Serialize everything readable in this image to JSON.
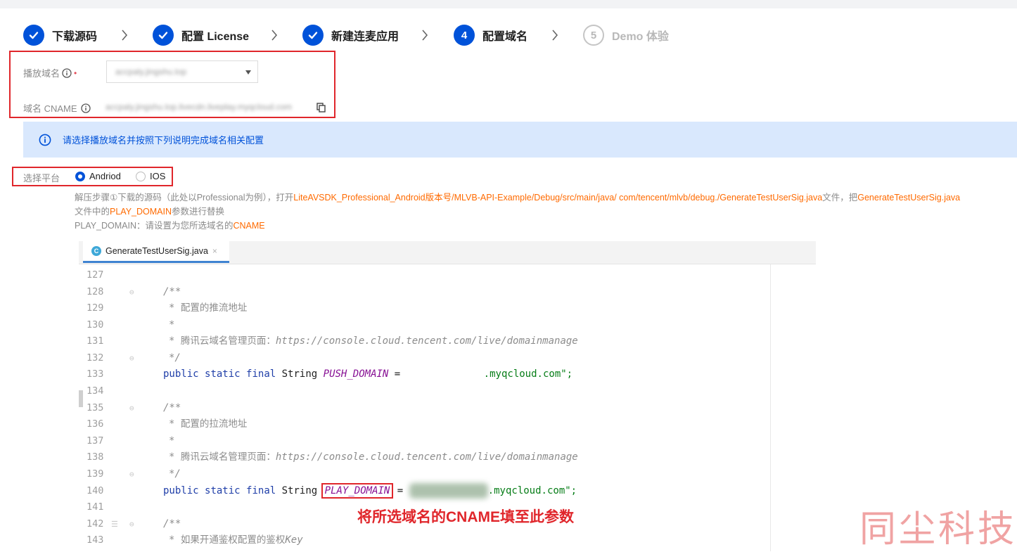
{
  "steps": [
    {
      "label": "下载源码",
      "state": "done",
      "icon": "check-icon"
    },
    {
      "label": "配置 License",
      "state": "done",
      "icon": "check-icon"
    },
    {
      "label": "新建连麦应用",
      "state": "done",
      "icon": "check-icon"
    },
    {
      "label": "配置域名",
      "state": "active",
      "number": "4"
    },
    {
      "label": "Demo 体验",
      "state": "todo",
      "number": "5"
    }
  ],
  "form": {
    "play_domain_label": "播放域名",
    "required_mark": "•",
    "play_domain_value": "accpaly.jingshu.top",
    "cname_label": "域名 CNAME",
    "cname_value": "accpaly.jingshu.top.livecdn.liveplay.myqcloud.com"
  },
  "banner": {
    "text": "请选择播放域名并按照下列说明完成域名相关配置"
  },
  "platform": {
    "label": "选择平台",
    "options": [
      {
        "label": "Andriod",
        "selected": true
      },
      {
        "label": "IOS",
        "selected": false
      }
    ]
  },
  "instructions": {
    "line1_prefix": "解压步骤①下载的源码（此处以Professional为例），打开",
    "line1_path": "LiteAVSDK_Professional_Android版本号/MLVB-API-Example/Debug/src/main/java/ com/tencent/mlvb/debug./GenerateTestUserSig.java",
    "line1_mid": "文件，把",
    "line1_file": "GenerateTestUserSig.java",
    "line2_prefix": "文件中的",
    "line2_param": "PLAY_DOMAIN",
    "line2_suffix": "参数进行替换",
    "line3_prefix": "PLAY_DOMAIN：请设置为您所选域名的",
    "line3_cname": "CNAME"
  },
  "ide": {
    "tab_icon": "C",
    "tab_name": "GenerateTestUserSig.java",
    "tab_close": "×",
    "lines": [
      {
        "n": "127",
        "text": ""
      },
      {
        "n": "128",
        "text": "/**"
      },
      {
        "n": "129",
        "text": " * 配置的推流地址"
      },
      {
        "n": "130",
        "text": " *"
      },
      {
        "n": "131",
        "text": " * 腾讯云域名管理页面：https://console.cloud.tencent.com/live/domainmanage"
      },
      {
        "n": "132",
        "text": " */"
      },
      {
        "n": "133",
        "text": "public static final String PUSH_DOMAIN = \".myqcloud.com\";"
      },
      {
        "n": "134",
        "text": ""
      },
      {
        "n": "135",
        "text": "/**"
      },
      {
        "n": "136",
        "text": " * 配置的拉流地址"
      },
      {
        "n": "137",
        "text": " *"
      },
      {
        "n": "138",
        "text": " * 腾讯云域名管理页面：https://console.cloud.tencent.com/live/domainmanage"
      },
      {
        "n": "139",
        "text": " */"
      },
      {
        "n": "140",
        "text": "public static final String PLAY_DOMAIN = \".myqcloud.com\";"
      },
      {
        "n": "141",
        "text": ""
      },
      {
        "n": "142",
        "text": "/**"
      },
      {
        "n": "143",
        "text": " * 如果开通鉴权配置的鉴权Key"
      }
    ],
    "kw": {
      "public": "public",
      "static": "static",
      "final": "final",
      "type": "String",
      "eq": "=",
      "str_suffix": ".myqcloud.com\";"
    },
    "comment_open": "/**",
    "comment_star": "*",
    "comment_close": "*/",
    "push_field": "PUSH_DOMAIN",
    "play_field": "PLAY_DOMAIN",
    "push_cn": "配置的推流地址",
    "pull_cn": "配置的拉流地址",
    "console_cn": "腾讯云域名管理页面：",
    "console_url": "https://console.cloud.tencent.com/live/domainmanage",
    "auth_cn": "如果开通鉴权配置的鉴权",
    "auth_key": "Key"
  },
  "annotation": "将所选域名的CNAME填至此参数",
  "watermark": "同尘科技",
  "colors": {
    "primary": "#0052d9",
    "annotation_red": "#e0262b",
    "highlight_orange": "#ff6a00",
    "banner_bg": "#d9e8fd"
  }
}
